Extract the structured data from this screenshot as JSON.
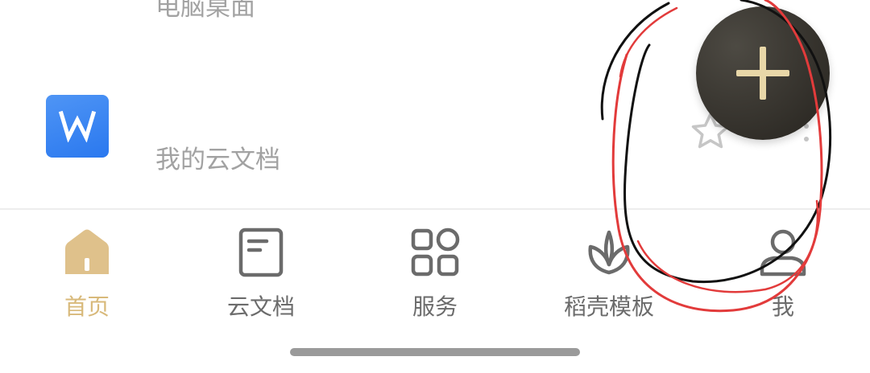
{
  "file_list": {
    "items": [
      {
        "location": "电脑桌面",
        "icon": "wps-writer-icon"
      },
      {
        "location": "我的云文档",
        "icon": "wps-writer-icon",
        "starred": false
      }
    ]
  },
  "fab": {
    "icon": "plus-icon",
    "color": "#3b3832",
    "icon_color": "#e8d7a8"
  },
  "tab_bar": {
    "active_color": "#d8b97a",
    "inactive_color": "#6b6b6b",
    "tabs": [
      {
        "label": "首页",
        "icon": "home-icon",
        "active": true
      },
      {
        "label": "云文档",
        "icon": "document-icon",
        "active": false
      },
      {
        "label": "服务",
        "icon": "grid-icon",
        "active": false
      },
      {
        "label": "稻壳模板",
        "icon": "leaf-icon",
        "active": false
      },
      {
        "label": "我",
        "icon": "user-icon",
        "active": false
      }
    ]
  },
  "annotation": {
    "type": "hand-drawn-circle",
    "colors": [
      "#000000",
      "#e23b3b"
    ]
  }
}
